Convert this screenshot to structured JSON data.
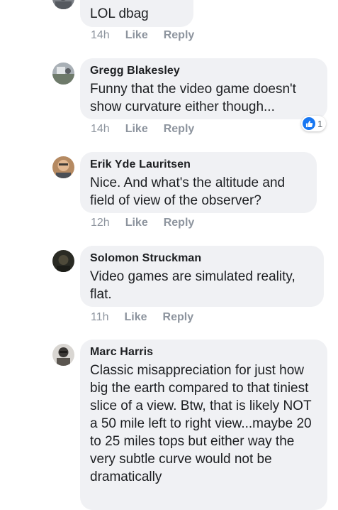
{
  "comments": [
    {
      "author": "",
      "text": "LOL dbag",
      "time": "14h",
      "like_label": "Like",
      "reply_label": "Reply"
    },
    {
      "author": "Gregg Blakesley",
      "text": "Funny that the video game doesn't show curvature either though...",
      "time": "14h",
      "like_label": "Like",
      "reply_label": "Reply",
      "reaction_count": "1",
      "reaction_icon": "thumbs-up-icon"
    },
    {
      "author": "Erik Yde Lauritsen",
      "text": "Nice. And what's the altitude and field of view of the observer?",
      "time": "12h",
      "like_label": "Like",
      "reply_label": "Reply"
    },
    {
      "author": "Solomon Struckman",
      "text": "Video games are simulated reality, flat.",
      "time": "11h",
      "like_label": "Like",
      "reply_label": "Reply"
    },
    {
      "author": "Marc Harris",
      "text": "Classic misappreciation for just how big the earth compared to that tiniest slice of a view. Btw, that is likely NOT a 50 mile left to right view...maybe 20 to 25 miles tops but either way the very subtle curve would not be dramatically",
      "time": "",
      "like_label": "",
      "reply_label": ""
    }
  ],
  "colors": {
    "bubble": "#f0f1f4",
    "meta_text": "#8d949e",
    "like_blue": "#1877f2"
  }
}
